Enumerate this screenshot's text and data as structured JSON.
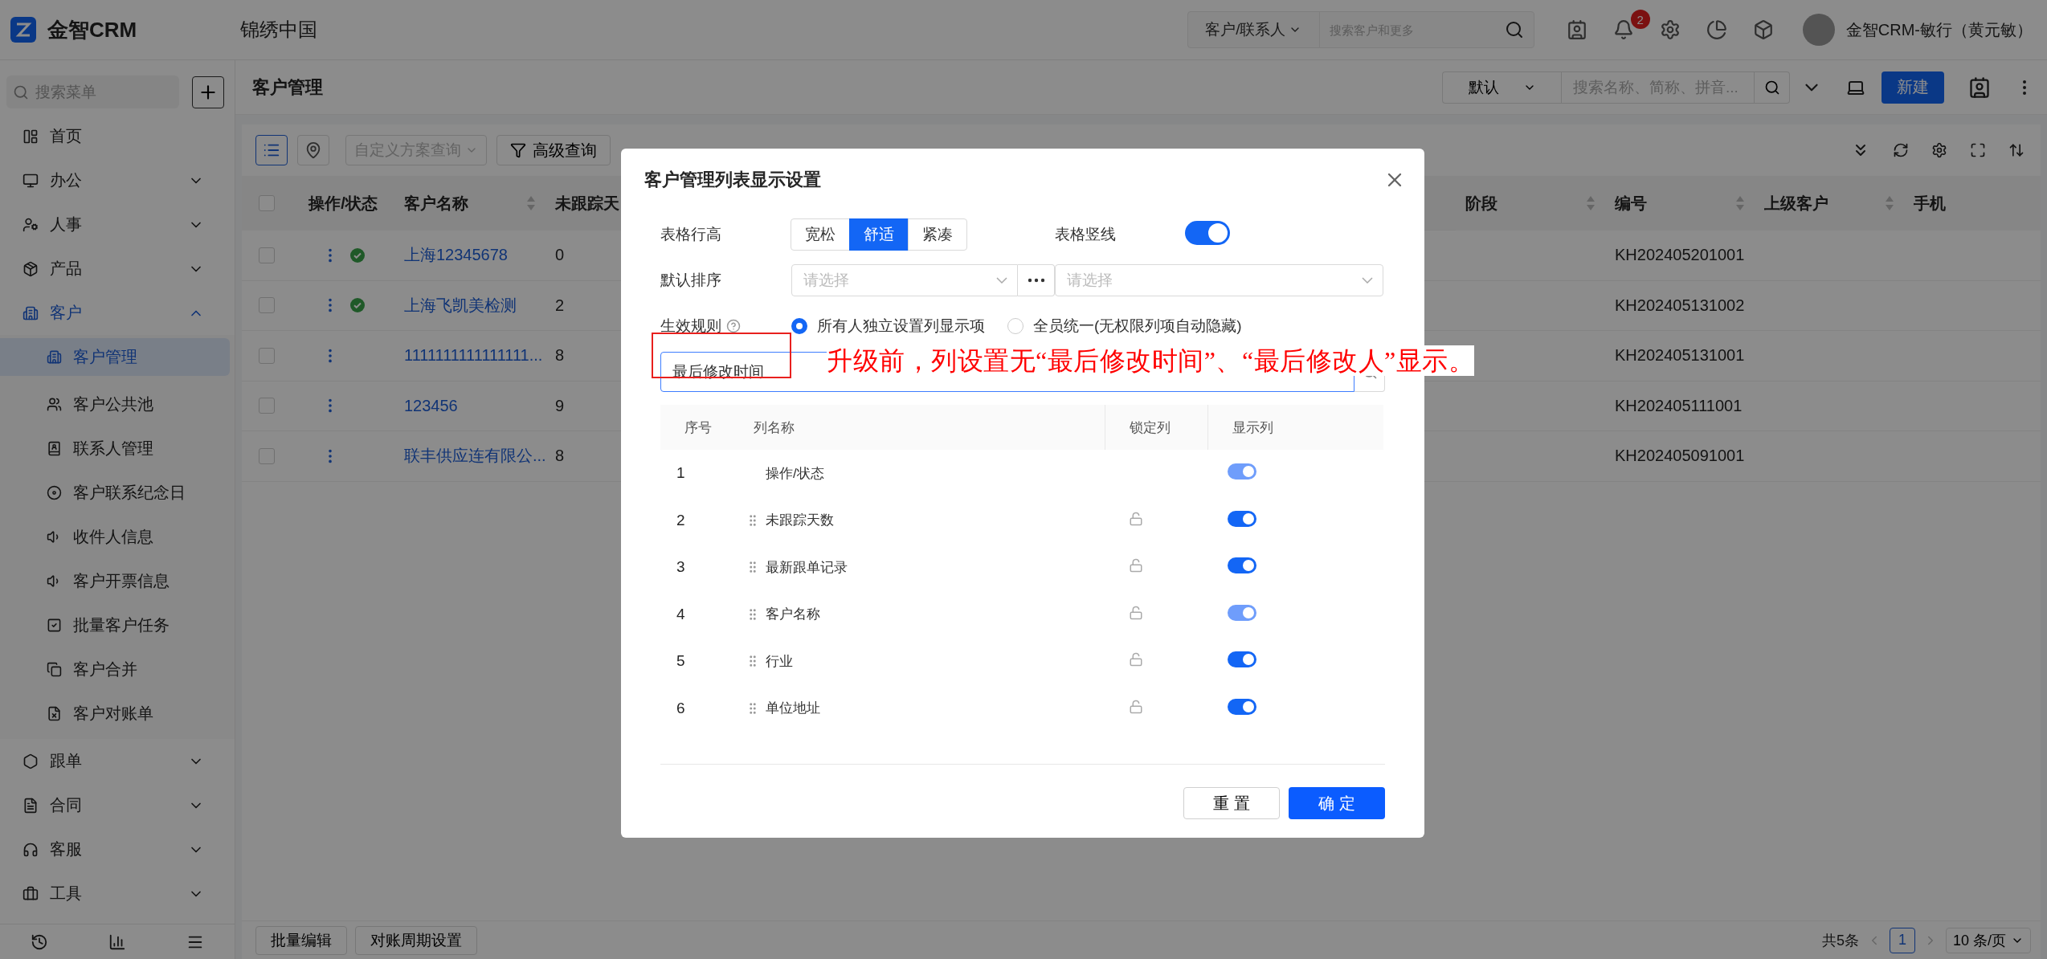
{
  "app": {
    "brand": "金智CRM",
    "company": "锦绣中国"
  },
  "top_search": {
    "scope": "客户/联系人",
    "placeholder": "搜索客户和更多"
  },
  "notifications": {
    "badge": "2"
  },
  "user": {
    "name": "金智CRM-敏行（黄元敏）"
  },
  "sidebar": {
    "search_placeholder": "搜索菜单",
    "items": [
      {
        "label": "首页",
        "selected": false
      },
      {
        "label": "办公",
        "selected": false,
        "expanded": false
      },
      {
        "label": "人事",
        "selected": false,
        "expanded": false
      },
      {
        "label": "产品",
        "selected": false,
        "expanded": false
      },
      {
        "label": "客户",
        "selected": true,
        "expanded": true,
        "children": [
          {
            "label": "客户管理",
            "selected": true
          },
          {
            "label": "客户公共池",
            "selected": false
          },
          {
            "label": "联系人管理",
            "selected": false
          },
          {
            "label": "客户联系纪念日",
            "selected": false
          },
          {
            "label": "收件人信息",
            "selected": false
          },
          {
            "label": "客户开票信息",
            "selected": false
          },
          {
            "label": "批量客户任务",
            "selected": false
          },
          {
            "label": "客户合并",
            "selected": false
          },
          {
            "label": "客户对账单",
            "selected": false
          }
        ]
      },
      {
        "label": "跟单",
        "selected": false,
        "expanded": false
      },
      {
        "label": "合同",
        "selected": false,
        "expanded": false
      },
      {
        "label": "客服",
        "selected": false,
        "expanded": false
      },
      {
        "label": "工具",
        "selected": false,
        "expanded": false
      }
    ]
  },
  "page_header": {
    "title": "客户管理",
    "view": "默认",
    "search_placeholder": "搜索名称、简称、拼音...",
    "new_button": "新建"
  },
  "toolbar": {
    "view_buttons": [
      {
        "selected": true
      },
      {
        "selected": false
      }
    ],
    "scheme_placeholder": "自定义方案查询",
    "advanced": "高级查询"
  },
  "table": {
    "header_checked": false,
    "columns": [
      {
        "label": "操作/状态",
        "sortable": false
      },
      {
        "label": "客户名称",
        "sortable": true
      },
      {
        "label": "未跟踪天",
        "sortable": false
      },
      {
        "label": "阶段",
        "sortable": true
      },
      {
        "label": "编号",
        "sortable": true
      },
      {
        "label": "上级客户",
        "sortable": true
      },
      {
        "label": "手机",
        "sortable": false
      }
    ],
    "rows": [
      {
        "checked": false,
        "status_ok": true,
        "name": "上海12345678",
        "days": "0",
        "code": "KH202405201001"
      },
      {
        "checked": false,
        "status_ok": true,
        "name": "上海飞凯美检测",
        "days": "2",
        "code": "KH202405131002"
      },
      {
        "checked": false,
        "status_ok": false,
        "name": "1111111111111111...",
        "days": "8",
        "code": "KH202405131001"
      },
      {
        "checked": false,
        "status_ok": false,
        "name": "123456",
        "days": "9",
        "code": "KH202405111001"
      },
      {
        "checked": false,
        "status_ok": false,
        "name": "联丰供应连有限公...",
        "days": "8",
        "code": "KH202405091001"
      }
    ]
  },
  "footer": {
    "buttons": [
      "批量编辑",
      "对账周期设置"
    ],
    "total": "共5条",
    "page": "1",
    "page_size": "10 条/页"
  },
  "modal": {
    "title": "客户管理列表显示设置",
    "row_height": {
      "label": "表格行高",
      "options": [
        {
          "label": "宽松",
          "selected": false
        },
        {
          "label": "舒适",
          "selected": true
        },
        {
          "label": "紧凑",
          "selected": false
        }
      ]
    },
    "grid_lines": {
      "label": "表格竖线",
      "on": true
    },
    "sort": {
      "label": "默认排序",
      "placeholder": "请选择",
      "second_placeholder": "请选择"
    },
    "rule": {
      "label": "生效规则",
      "options": [
        {
          "label": "所有人独立设置列显示项",
          "selected": true
        },
        {
          "label": "全员统一(无权限列项自动隐藏)",
          "selected": false
        }
      ]
    },
    "column_search": {
      "value": "最后修改时间"
    },
    "list": {
      "headers": [
        "序号",
        "列名称",
        "锁定列",
        "显示列"
      ],
      "rows": [
        {
          "index": "1",
          "name": "操作/状态",
          "draggable": false,
          "lockable": false,
          "shown": true,
          "disabled": true
        },
        {
          "index": "2",
          "name": "未跟踪天数",
          "draggable": true,
          "lockable": true,
          "shown": true,
          "disabled": false
        },
        {
          "index": "3",
          "name": "最新跟单记录",
          "draggable": true,
          "lockable": true,
          "shown": true,
          "disabled": false
        },
        {
          "index": "4",
          "name": "客户名称",
          "draggable": true,
          "lockable": true,
          "shown": true,
          "disabled": true
        },
        {
          "index": "5",
          "name": "行业",
          "draggable": true,
          "lockable": true,
          "shown": true,
          "disabled": false
        },
        {
          "index": "6",
          "name": "单位地址",
          "draggable": true,
          "lockable": true,
          "shown": true,
          "disabled": false
        }
      ]
    },
    "buttons": {
      "reset": "重 置",
      "ok": "确 定"
    }
  },
  "annotation": {
    "text": "升级前，列设置无“最后修改时间”、“最后修改人”显示。"
  }
}
